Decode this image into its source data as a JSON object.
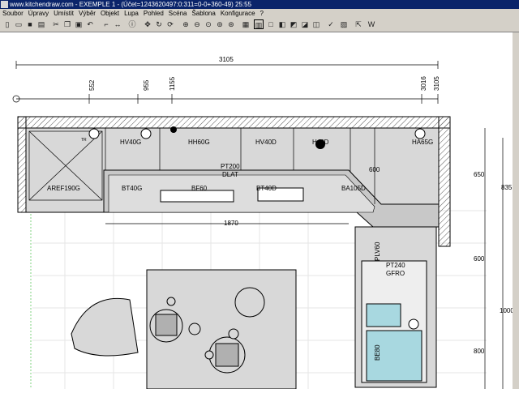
{
  "window": {
    "title": "www.kitchendraw.com - EXEMPLE 1 - (Účet=1243620497:0:311=0-0+360-49) 25:55"
  },
  "menu": [
    "Soubor",
    "Úpravy",
    "Umístit",
    "Výběr",
    "Objekt",
    "Lupa",
    "Pohled",
    "Scéna",
    "Šablona",
    "Konfigurace",
    "?"
  ],
  "toolbar_icons": [
    "new-icon",
    "open-icon",
    "save-icon",
    "print-icon",
    "cut-icon",
    "copy-icon",
    "paste-icon",
    "undo-icon",
    "place-icon",
    "measure-icon",
    "info-icon",
    "move-icon",
    "rotate-icon",
    "refresh-icon",
    "zoom-in-icon",
    "zoom-out-icon",
    "zoom-window-icon",
    "zoom-all-icon",
    "zoom-prev-icon",
    "plan-view-icon",
    "front-view-icon",
    "box-icon",
    "view3d-icon",
    "camera-icon",
    "render-icon",
    "photo-icon",
    "check-icon",
    "chart-icon",
    "select-icon",
    "word-icon"
  ],
  "dimensions": {
    "top_total": "3105",
    "marks": [
      "552",
      "955",
      "1155",
      "3016",
      "3105"
    ],
    "run": "1870",
    "right_depth": "600",
    "side_a": "650",
    "side_b": "835",
    "side_c": "600",
    "side_d": "1000",
    "side_e": "800"
  },
  "labels": {
    "aref": "AREF190G",
    "hv40g": "HV40G",
    "hh60g": "HH60G",
    "hv40d": "HV40D",
    "h40d": "H40D",
    "ha65g": "HA65G",
    "pt200": "PT200",
    "dlat": "DLAT",
    "bt40g": "BT40G",
    "bf60": "BF60",
    "bt40d": "BT40D",
    "ba105d": "BA105D",
    "plv60": "PLV60",
    "pt240": "PT240",
    "gfro": "GFRO",
    "be80": "BE80",
    "tr": "TR"
  }
}
